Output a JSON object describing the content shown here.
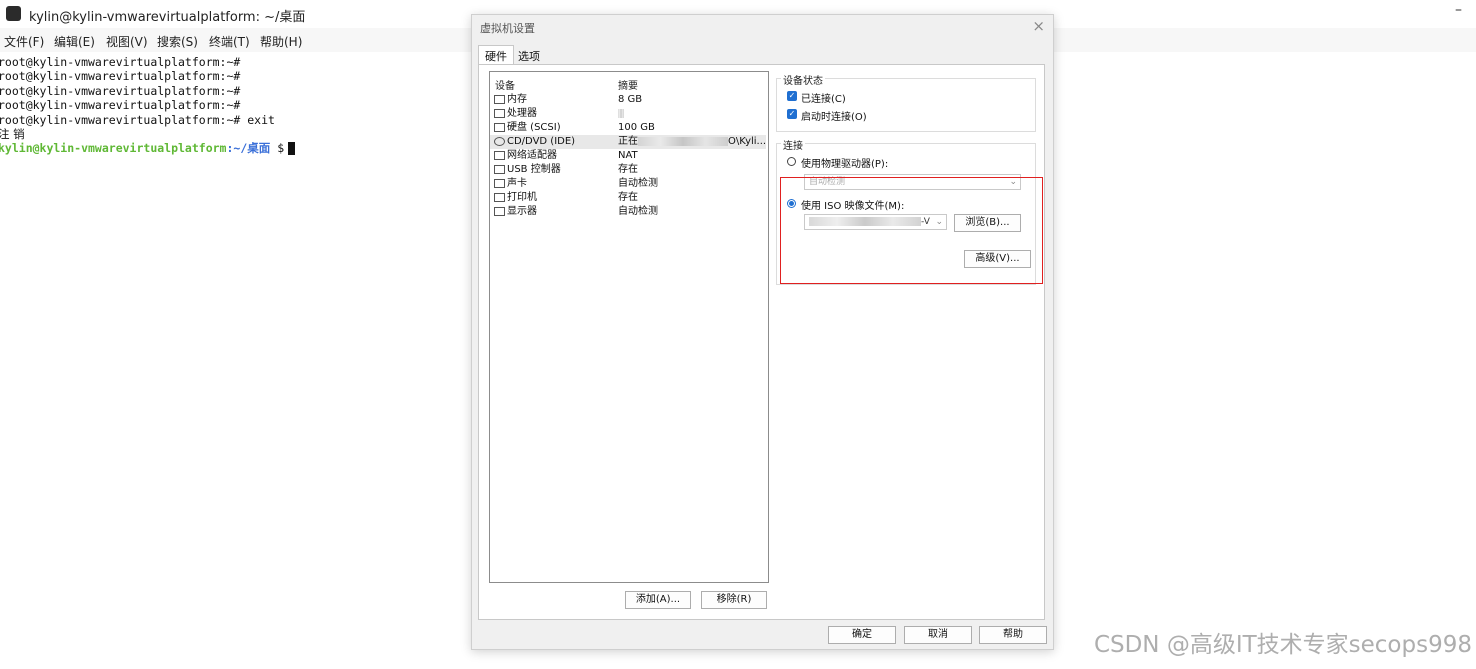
{
  "terminal": {
    "title": "kylin@kylin-vmwarevirtualplatform: ~/桌面",
    "minimize": "–",
    "menu": [
      "文件(F)",
      "编辑(E)",
      "视图(V)",
      "搜索(S)",
      "终端(T)",
      "帮助(H)"
    ],
    "lines": [
      "root@kylin-vmwarevirtualplatform:~#",
      "root@kylin-vmwarevirtualplatform:~#",
      "root@kylin-vmwarevirtualplatform:~#",
      "root@kylin-vmwarevirtualplatform:~#",
      "root@kylin-vmwarevirtualplatform:~# exit",
      "注 销"
    ],
    "prompt_user": "kylin@kylin-vmwarevirtualplatform",
    "prompt_path": ":~/桌面",
    "prompt_symbol": " $"
  },
  "dialog": {
    "title": "虚拟机设置",
    "close": "×",
    "tabs": [
      "硬件",
      "选项"
    ],
    "device_header": "设备",
    "summary_header": "摘要",
    "devices": [
      {
        "name": "内存",
        "summary": "8 GB"
      },
      {
        "name": "处理器",
        "summary": ""
      },
      {
        "name": "硬盘 (SCSI)",
        "summary": "100 GB"
      },
      {
        "name": "CD/DVD (IDE)",
        "summary": "正在",
        "summary_tail": "O\\Kyli..."
      },
      {
        "name": "网络适配器",
        "summary": "NAT"
      },
      {
        "name": "USB 控制器",
        "summary": "存在"
      },
      {
        "name": "声卡",
        "summary": "自动检测"
      },
      {
        "name": "打印机",
        "summary": "存在"
      },
      {
        "name": "显示器",
        "summary": "自动检测"
      }
    ],
    "add_button": "添加(A)...",
    "remove_button": "移除(R)",
    "device_status": {
      "title": "设备状态",
      "connected": "已连接(C)",
      "connect_at_power_on": "启动时连接(O)"
    },
    "connection": {
      "title": "连接",
      "use_physical_drive": "使用物理驱动器(P):",
      "physical_drive_value": "自动检测",
      "use_iso": "使用 ISO 映像文件(M):",
      "iso_value_tail": "-V",
      "browse_button": "浏览(B)...",
      "advanced_button": "高级(V)..."
    },
    "ok_button": "确定",
    "cancel_button": "取消",
    "help_button": "帮助"
  },
  "watermark": "CSDN @高级IT技术专家secops998",
  "colors": {
    "highlight_box": "#e02020",
    "prompt_green": "#5fb835",
    "prompt_blue": "#3a6fd8",
    "checkbox_blue": "#1f6fd1"
  }
}
